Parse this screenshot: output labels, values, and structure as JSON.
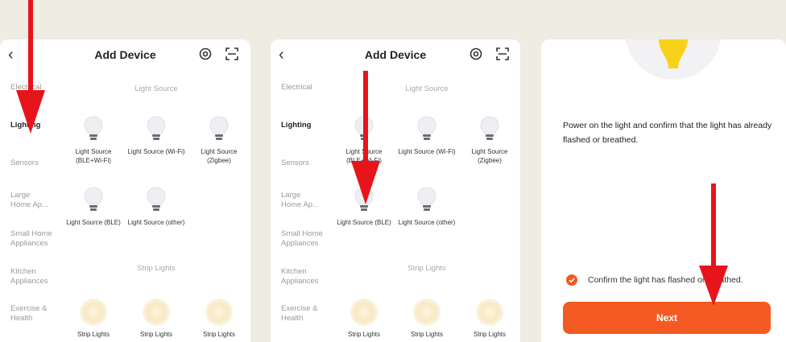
{
  "screens": [
    {
      "title": "Add Device",
      "categories": [
        "Electrical",
        "Lighting",
        "Sensors",
        "Large Home Ap...",
        "Small Home Appliances",
        "Kitchen Appliances",
        "Exercise & Health"
      ],
      "section_light": "Light Source",
      "section_strip": "Strip Lights",
      "devices": [
        "Light Source (BLE+Wi-Fi)",
        "Light Source (Wi-Fi)",
        "Light Source (Zigbee)",
        "Light Source (BLE)",
        "Light Source (other)"
      ],
      "strips": [
        "Strip Lights",
        "Strip Lights",
        "Strip Lights"
      ]
    },
    {
      "title": "Add Device",
      "categories": [
        "Electrical",
        "Lighting",
        "Sensors",
        "Large Home Ap...",
        "Small Home Appliances",
        "Kitchen Appliances",
        "Exercise & Health"
      ],
      "section_light": "Light Source",
      "section_strip": "Strip Lights",
      "devices": [
        "Light Source (BLE+Wi-Fi)",
        "Light Source (Wi-Fi)",
        "Light Source (Zigbee)",
        "Light Source (BLE)",
        "Light Source (other)"
      ],
      "strips": [
        "Strip Lights",
        "Strip Lights",
        "Strip Lights"
      ]
    },
    {
      "instruction": "Power on the light and confirm that the light has already flashed or breathed.",
      "confirm": "Confirm the light has flashed or breathed.",
      "next": "Next"
    }
  ],
  "colors": {
    "accent": "#f55a22",
    "arrow": "#e8141c",
    "background": "#efece4"
  },
  "icons": [
    "back-chevron-icon",
    "at-symbol-icon",
    "scan-icon",
    "bulb-icon",
    "strip-light-icon",
    "check-circle-icon",
    "down-arrow-annotation"
  ]
}
